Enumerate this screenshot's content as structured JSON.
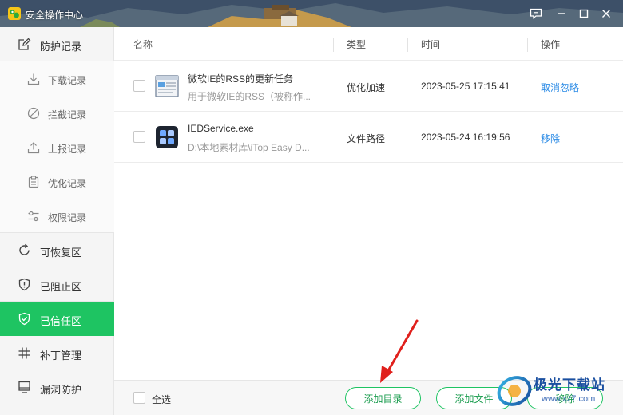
{
  "window": {
    "title": "安全操作中心"
  },
  "sidebar": {
    "group": {
      "label": "防护记录",
      "icon": "edit-note-icon"
    },
    "sub_items": [
      {
        "label": "下载记录",
        "icon": "download-icon"
      },
      {
        "label": "拦截记录",
        "icon": "block-icon"
      },
      {
        "label": "上报记录",
        "icon": "upload-icon"
      },
      {
        "label": "优化记录",
        "icon": "clipboard-icon"
      },
      {
        "label": "权限记录",
        "icon": "sliders-icon"
      }
    ],
    "items": [
      {
        "label": "可恢复区",
        "icon": "restore-icon",
        "active": false
      },
      {
        "label": "已阻止区",
        "icon": "shield-alert-icon",
        "active": false
      },
      {
        "label": "已信任区",
        "icon": "shield-check-icon",
        "active": true
      },
      {
        "label": "补丁管理",
        "icon": "grid-icon",
        "active": false
      },
      {
        "label": "漏洞防护",
        "icon": "monitor-icon",
        "active": false
      }
    ]
  },
  "table": {
    "columns": [
      "名称",
      "类型",
      "时间",
      "操作"
    ],
    "rows": [
      {
        "name": "微软IE的RSS的更新任务",
        "path": "用于微软IE的RSS（被称作...",
        "type": "优化加速",
        "time": "2023-05-25 17:15:41",
        "action": "取消忽略",
        "icon": "window-task-icon"
      },
      {
        "name": "IEDService.exe",
        "path": "D:\\本地素材库\\iTop Easy D...",
        "type": "文件路径",
        "time": "2023-05-24 16:19:56",
        "action": "移除",
        "icon": "app-tiles-icon"
      }
    ]
  },
  "footer": {
    "select_all": "全选",
    "add_dir": "添加目录",
    "add_file": "添加文件",
    "remove": "移除"
  },
  "watermark": {
    "text": "极光下载站",
    "url": "www.xz7.com"
  },
  "colors": {
    "accent": "#1ec462",
    "link": "#2d8ce6",
    "annotation_arrow": "#e0201c"
  }
}
